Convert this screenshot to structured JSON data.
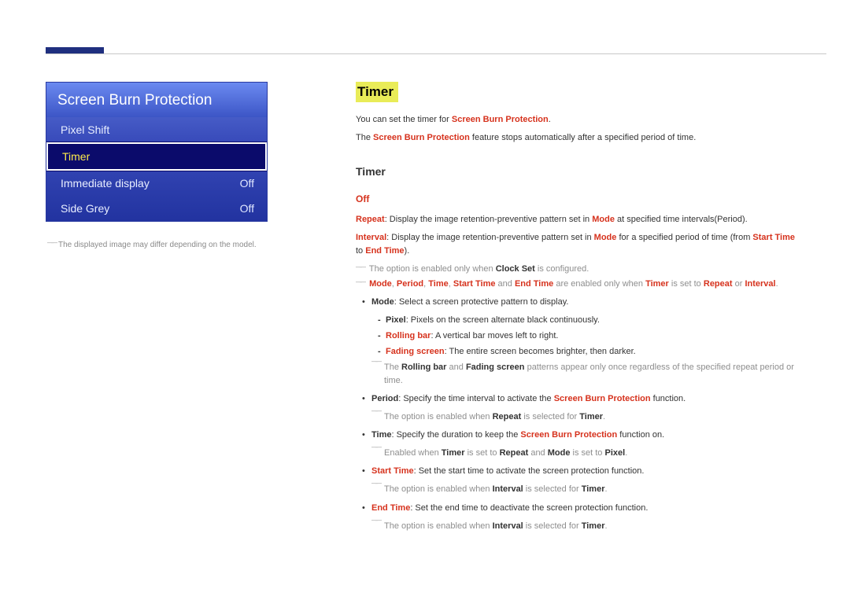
{
  "menu": {
    "title": "Screen Burn Protection",
    "items": [
      {
        "label": "Pixel Shift",
        "value": ""
      },
      {
        "label": "Timer",
        "value": ""
      },
      {
        "label": "Immediate display",
        "value": "Off"
      },
      {
        "label": "Side Grey",
        "value": "Off"
      }
    ],
    "note": "The displayed image may differ depending on the model."
  },
  "content": {
    "title": "Timer",
    "intro1_a": "You can set the timer for ",
    "intro1_b": "Screen Burn Protection",
    "intro1_c": ".",
    "intro2_a": "The ",
    "intro2_b": "Screen Burn Protection",
    "intro2_c": " feature stops automatically after a specified period of time.",
    "subtitle": "Timer",
    "off_label": "Off",
    "repeat_a": "Repeat",
    "repeat_b": ": Display the image retention-preventive pattern set in ",
    "repeat_c": "Mode",
    "repeat_d": " at specified time intervals(Period).",
    "interval_a": "Interval",
    "interval_b": ": Display the image retention-preventive pattern set in ",
    "interval_c": "Mode",
    "interval_d": " for a specified period of time (from ",
    "interval_e": "Start Time",
    "interval_f": " to ",
    "interval_g": "End Time",
    "interval_h": ").",
    "note1_a": "The option is enabled only when ",
    "note1_b": "Clock Set",
    "note1_c": " is configured.",
    "note2_a": "Mode",
    "note2_b": "Period",
    "note2_c": "Time",
    "note2_d": "Start Time",
    "note2_e": "End Time",
    "note2_mid": " and ",
    "note2_f": " are enabled only when ",
    "note2_g": "Timer",
    "note2_h": " is set to ",
    "note2_i": "Repeat",
    "note2_j": " or ",
    "note2_k": "Interval",
    "note2_l": ".",
    "mode_a": "Mode",
    "mode_b": ": Select a screen protective pattern to display.",
    "pixel_a": "Pixel",
    "pixel_b": ": Pixels on the screen alternate black continuously.",
    "rolling_a": "Rolling bar",
    "rolling_b": ": A vertical bar moves left to right.",
    "fading_a": "Fading screen",
    "fading_b": ": The entire screen becomes brighter, then darker.",
    "note3_a": "The ",
    "note3_b": "Rolling bar",
    "note3_c": " and ",
    "note3_d": "Fading screen",
    "note3_e": " patterns appear only once regardless of the specified repeat period or time.",
    "period_a": "Period",
    "period_b": ": Specify the time interval to activate the ",
    "period_c": "Screen Burn Protection",
    "period_d": " function.",
    "note4_a": "The option is enabled when ",
    "note4_b": "Repeat",
    "note4_c": " is selected for ",
    "note4_d": "Timer",
    "note4_e": ".",
    "time_a": "Time",
    "time_b": ": Specify the duration to keep the ",
    "time_c": "Screen Burn Protection",
    "time_d": " function on.",
    "note5_a": "Enabled when ",
    "note5_b": "Timer",
    "note5_c": " is set to ",
    "note5_d": "Repeat",
    "note5_e": " and ",
    "note5_f": "Mode",
    "note5_g": " is set to ",
    "note5_h": "Pixel",
    "note5_i": ".",
    "start_a": "Start Time",
    "start_b": ": Set the start time to activate the screen protection function.",
    "note6_a": "The option is enabled when ",
    "note6_b": "Interval",
    "note6_c": " is selected for ",
    "note6_d": "Timer",
    "note6_e": ".",
    "end_a": "End Time",
    "end_b": ": Set the end time to deactivate the screen protection function.",
    "note7_a": "The option is enabled when ",
    "note7_b": "Interval",
    "note7_c": " is selected for ",
    "note7_d": "Timer",
    "note7_e": "."
  }
}
